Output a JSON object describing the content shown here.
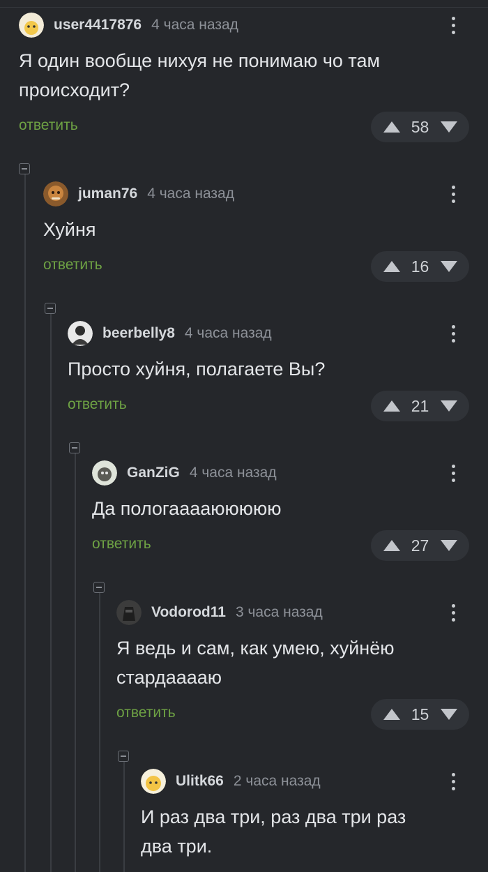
{
  "comments": [
    {
      "user": "user4417876",
      "time": "4 часа назад",
      "text": "Я один вообще нихуя не понимаю чо там происходит?",
      "reply": "ответить",
      "score": "58"
    },
    {
      "user": "juman76",
      "time": "4 часа назад",
      "text": "Хуйня",
      "reply": "ответить",
      "score": "16"
    },
    {
      "user": "beerbelly8",
      "time": "4 часа назад",
      "text": "Просто хуйня, полагаете Вы?",
      "reply": "ответить",
      "score": "21"
    },
    {
      "user": "GanZiG",
      "time": "4 часа назад",
      "text": "Да пологааааююююю",
      "reply": "ответить",
      "score": "27"
    },
    {
      "user": "Vodorod11",
      "time": "3 часа назад",
      "text": "Я ведь и сам, как умею, хуйнёю стардааааю",
      "reply": "ответить",
      "score": "15"
    },
    {
      "user": "Ulitk66",
      "time": "2 часа назад",
      "text": "И раз два три, раз два три раз два три."
    }
  ],
  "colors": {
    "background": "#25272b",
    "reply": "#6ea244",
    "vote_bg": "#303338"
  }
}
